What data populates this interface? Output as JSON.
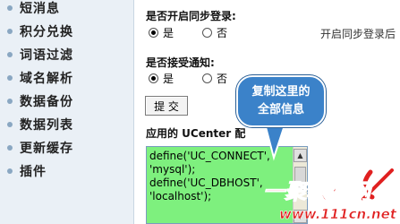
{
  "sidebar": {
    "items": [
      {
        "label": "短消息"
      },
      {
        "label": "积分兑换"
      },
      {
        "label": "词语过滤"
      },
      {
        "label": "域名解析"
      },
      {
        "label": "数据备份"
      },
      {
        "label": "数据列表"
      },
      {
        "label": "更新缓存"
      },
      {
        "label": "插件"
      }
    ]
  },
  "sync_login": {
    "label": "是否开启同步登录:",
    "yes": "是",
    "no": "否",
    "selected": "yes",
    "hint": "开启同步登录后"
  },
  "notify": {
    "label": "是否接受通知:",
    "yes": "是",
    "no": "否",
    "selected": "yes"
  },
  "submit_label": "提 交",
  "config_label": "应用的 UCenter 配",
  "config_text": "define('UC_CONNECT',\n'mysql');\ndefine('UC_DBHOST',\n'localhost');",
  "callout": {
    "line1": "复制这里的",
    "line2": "全部信息"
  },
  "watermark": {
    "brand": "一聚教程网",
    "url": "www.111cn.net"
  },
  "colors": {
    "sidebar_bg": "#eaf0f6",
    "highlight": "#7ef07e",
    "callout": "#3b82c9",
    "watermark_red": "#e02020"
  }
}
